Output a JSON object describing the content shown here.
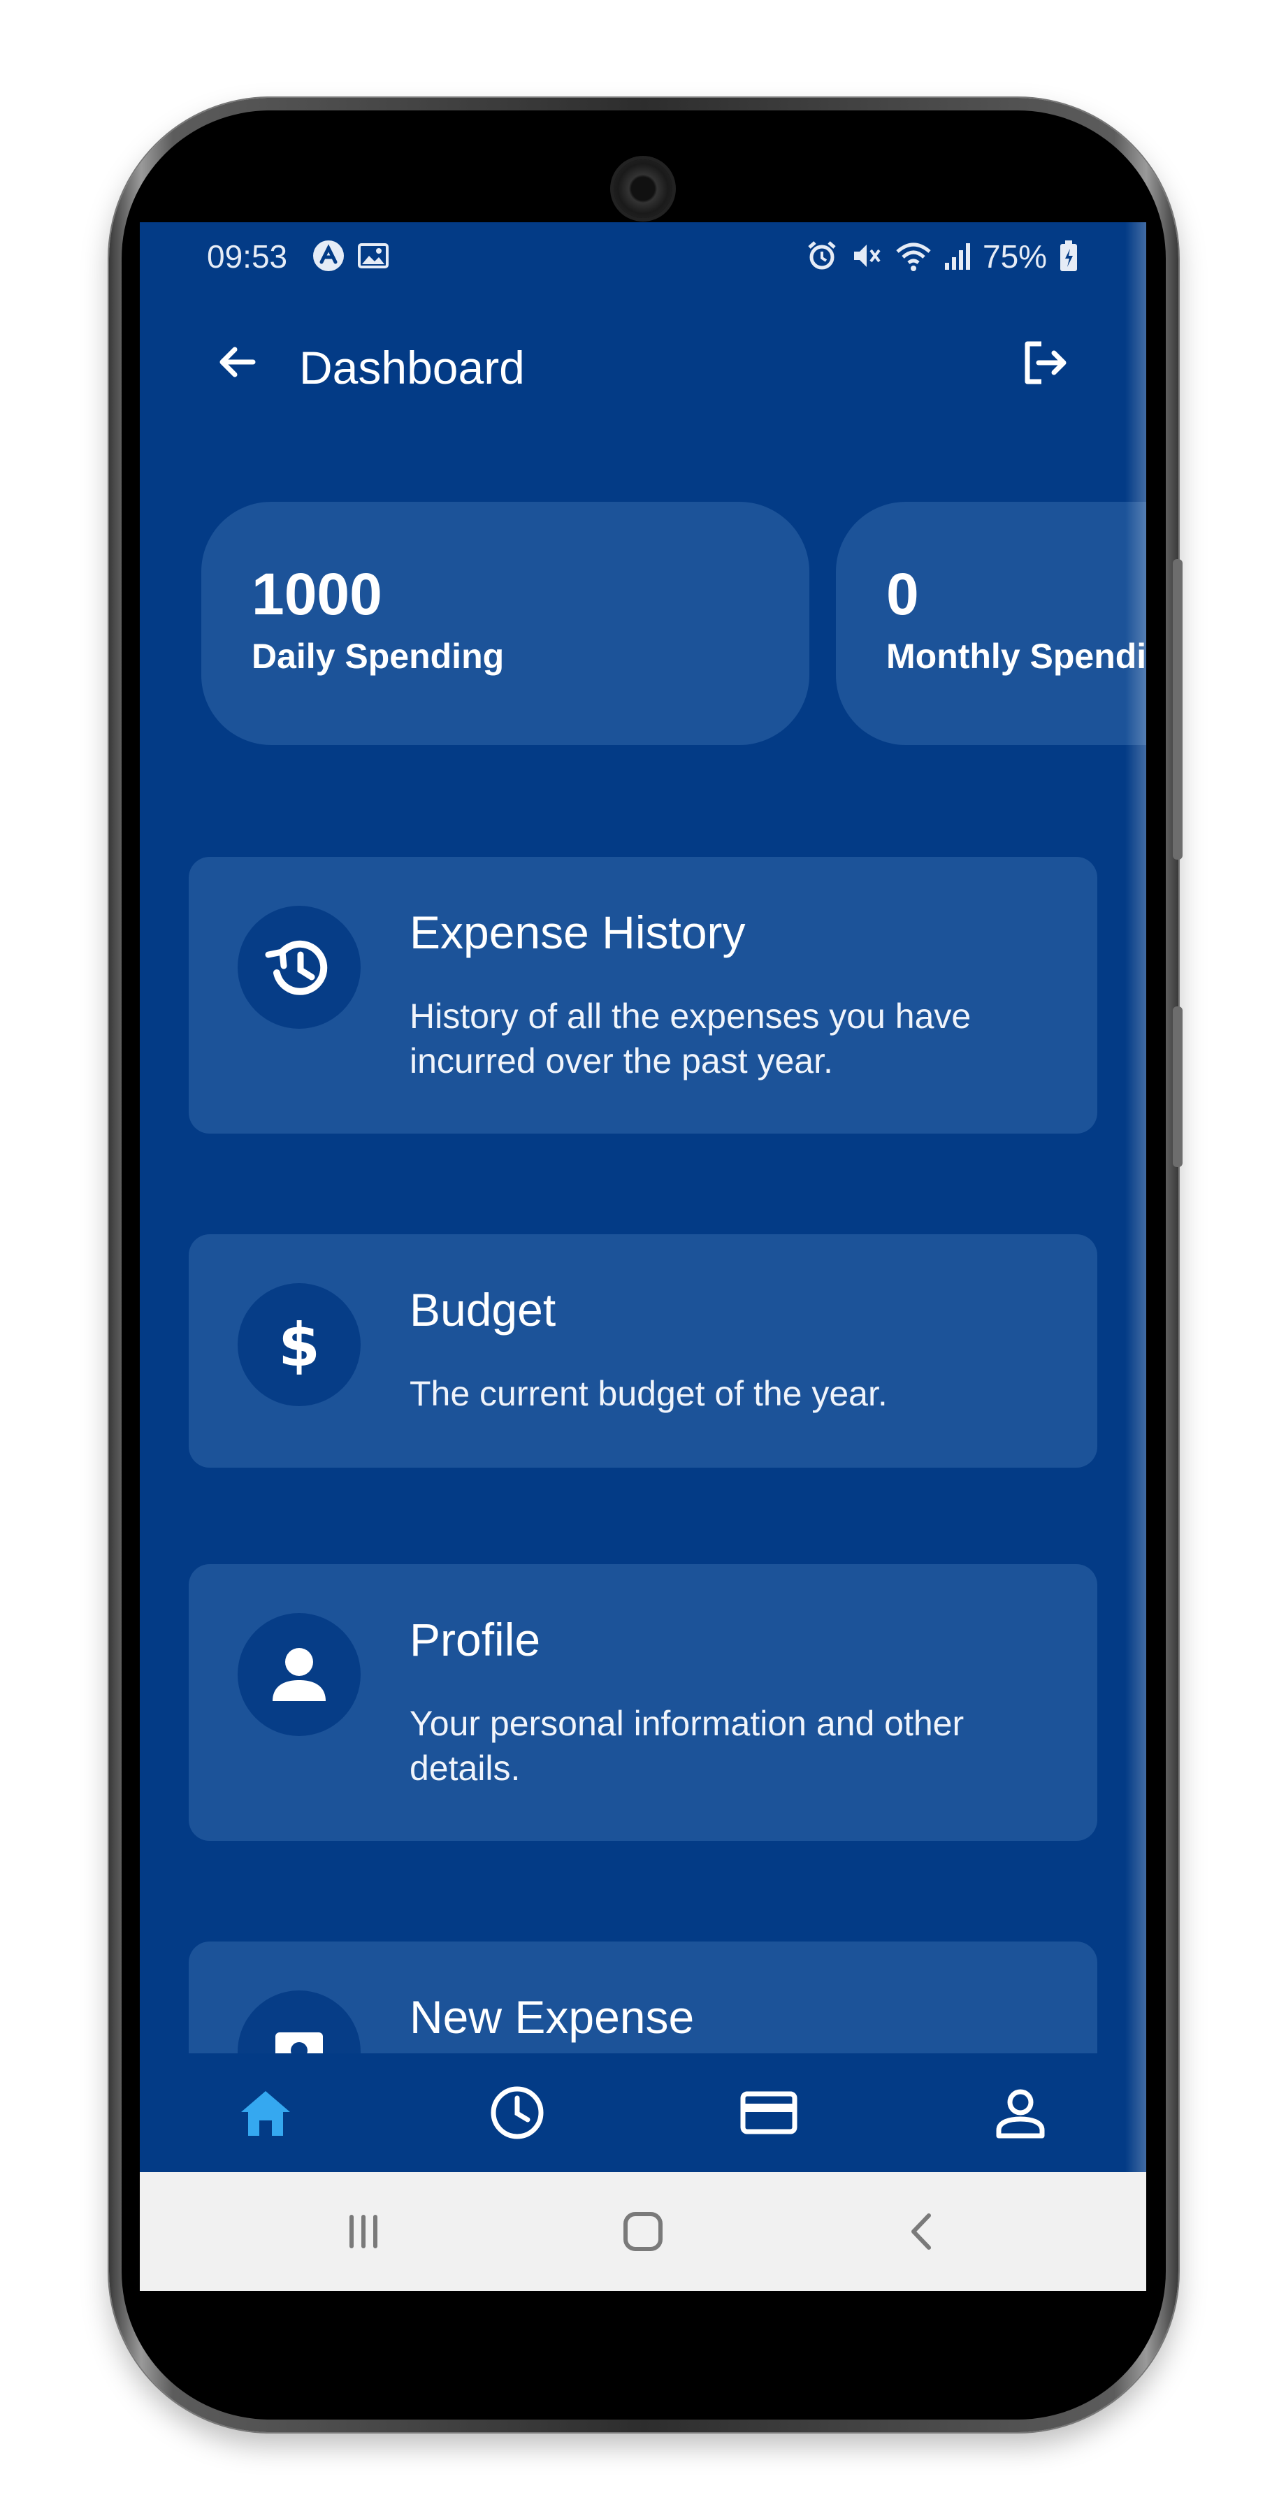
{
  "status_bar": {
    "time": "09:53",
    "battery": "75%"
  },
  "app_bar": {
    "title": "Dashboard"
  },
  "stats": [
    {
      "value": "1000",
      "label": "Daily Spending"
    },
    {
      "value": "0",
      "label": "Monthly Spending"
    }
  ],
  "menu": [
    {
      "title": "Expense History",
      "description": "History of all the expenses you have incurred over the past year.",
      "icon": "history-icon"
    },
    {
      "title": "Budget",
      "description": "The current budget of the year.",
      "icon": "dollar-icon"
    },
    {
      "title": "Profile",
      "description": "Your personal information and other details.",
      "icon": "person-icon"
    },
    {
      "title": "New Expense",
      "description": "",
      "icon": "receipt-icon"
    }
  ],
  "bottom_nav": {
    "items": [
      "home-icon",
      "history-icon",
      "card-icon",
      "profile-icon"
    ],
    "active": "home-icon"
  },
  "colors": {
    "background": "#033b86",
    "card": "#1c5399",
    "icon_circle": "#063d87",
    "active_nav": "#35a8f0"
  }
}
